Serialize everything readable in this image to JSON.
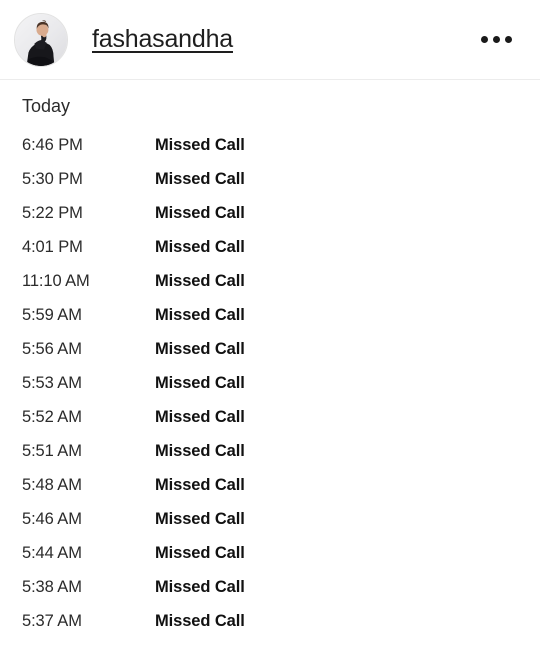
{
  "header": {
    "username": "fashasandha",
    "avatar_alt": "profile-photo",
    "more_menu_label": "..."
  },
  "call_log": {
    "day_label": "Today",
    "columns": [
      "time",
      "status"
    ],
    "rows": [
      {
        "time": "6:46 PM",
        "status": "Missed Call"
      },
      {
        "time": "5:30 PM",
        "status": "Missed Call"
      },
      {
        "time": "5:22 PM",
        "status": "Missed Call"
      },
      {
        "time": "4:01 PM",
        "status": "Missed Call"
      },
      {
        "time": "11:10 AM",
        "status": "Missed Call"
      },
      {
        "time": "5:59 AM",
        "status": "Missed Call"
      },
      {
        "time": "5:56 AM",
        "status": "Missed Call"
      },
      {
        "time": "5:53 AM",
        "status": "Missed Call"
      },
      {
        "time": "5:52 AM",
        "status": "Missed Call"
      },
      {
        "time": "5:51 AM",
        "status": "Missed Call"
      },
      {
        "time": "5:48 AM",
        "status": "Missed Call"
      },
      {
        "time": "5:46 AM",
        "status": "Missed Call"
      },
      {
        "time": "5:44 AM",
        "status": "Missed Call"
      },
      {
        "time": "5:38 AM",
        "status": "Missed Call"
      },
      {
        "time": "5:37 AM",
        "status": "Missed Call"
      }
    ]
  },
  "colors": {
    "background": "#ffffff",
    "primary_text": "#1e1e1e",
    "secondary_text": "#2b2b2b",
    "status_text": "#111111",
    "divider": "#ececec"
  }
}
